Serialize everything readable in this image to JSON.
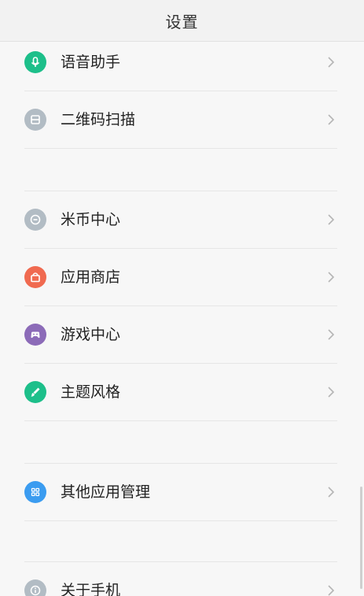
{
  "header": {
    "title": "设置"
  },
  "items": [
    {
      "label": "语音助手",
      "icon": "microphone-icon",
      "color": "#1dbf8a"
    },
    {
      "label": "二维码扫描",
      "icon": "qr-scan-icon",
      "color": "#b2bcc4"
    },
    {
      "label": "米币中心",
      "icon": "mi-coin-icon",
      "color": "#b2bcc4"
    },
    {
      "label": "应用商店",
      "icon": "shopping-bag-icon",
      "color": "#f06a50"
    },
    {
      "label": "游戏中心",
      "icon": "gamepad-icon",
      "color": "#8c6bb8"
    },
    {
      "label": "主题风格",
      "icon": "brush-icon",
      "color": "#1dbf8a"
    },
    {
      "label": "其他应用管理",
      "icon": "apps-grid-icon",
      "color": "#3b9cf0"
    },
    {
      "label": "关于手机",
      "icon": "info-icon",
      "color": "#b2bcc4"
    }
  ]
}
